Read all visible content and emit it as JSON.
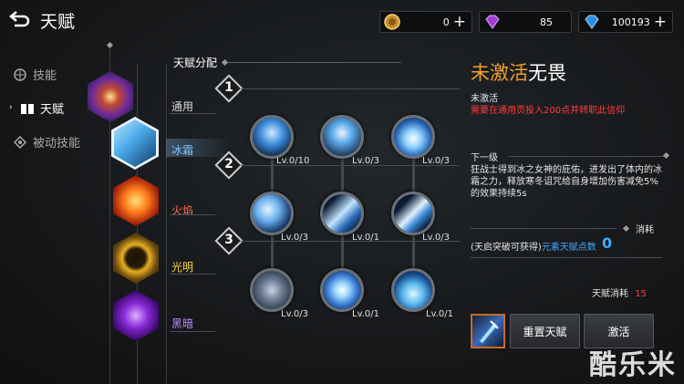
{
  "header": {
    "back_icon": "back-arrow-icon",
    "title": "天赋"
  },
  "resources": [
    {
      "name": "gold-coin",
      "icon": "gold-coin-icon",
      "value": "0",
      "plus": "+"
    },
    {
      "name": "purple-gem",
      "icon": "purple-gem-icon",
      "value": "85"
    },
    {
      "name": "blue-diamond",
      "icon": "blue-diamond-icon",
      "value": "100193",
      "plus": "+"
    }
  ],
  "nav": [
    {
      "label": "技能",
      "icon": "skill-icon"
    },
    {
      "label": "天赋",
      "icon": "book-icon",
      "active": true
    },
    {
      "label": "被动技能",
      "icon": "passive-icon"
    }
  ],
  "talent_header": "天赋分配",
  "categories": [
    {
      "label": "通用",
      "color": "#e6e6e6"
    },
    {
      "label": "冰霜",
      "color": "#7fc8ff"
    },
    {
      "label": "火焰",
      "color": "#ff6a4a"
    },
    {
      "label": "光明",
      "color": "#ffd24a"
    },
    {
      "label": "黑暗",
      "color": "#b98cff"
    }
  ],
  "rows": [
    "1",
    "2",
    "3"
  ],
  "skills": [
    {
      "level": "Lv.0/10"
    },
    {
      "level": "Lv.0/3"
    },
    {
      "level": "Lv.0/3"
    },
    {
      "level": "Lv.0/3"
    },
    {
      "level": "Lv.0/1"
    },
    {
      "level": "Lv.0/3"
    },
    {
      "level": "Lv.0/3"
    },
    {
      "level": "Lv.0/1"
    },
    {
      "level": "Lv.0/1"
    }
  ],
  "detail": {
    "title_status": "未激活",
    "title_name": "无畏",
    "status": "未激活",
    "requirement": "需要在通用页投入200点并转职此信仰",
    "next_level_label": "下一级",
    "description": "狂战士得到冰之女神的庇佑，进发出了体内的冰霜之力，释放寒冬诅咒给自身增加伤害减免5%的效果持续5s",
    "cost_label": "消耗",
    "obtain_text": "(天启突破可获得)",
    "element_points_label": "元素天赋点数",
    "element_points_value": "0",
    "talent_cost_label": "天赋消耗",
    "talent_cost_value": "15"
  },
  "buttons": {
    "reset": "重置天赋",
    "activate": "激活"
  },
  "watermark": "酷乐米",
  "colors": {
    "accent_orange": "#f0a030",
    "warning_red": "#ff3b3b",
    "value_blue": "#3fa9ff"
  }
}
